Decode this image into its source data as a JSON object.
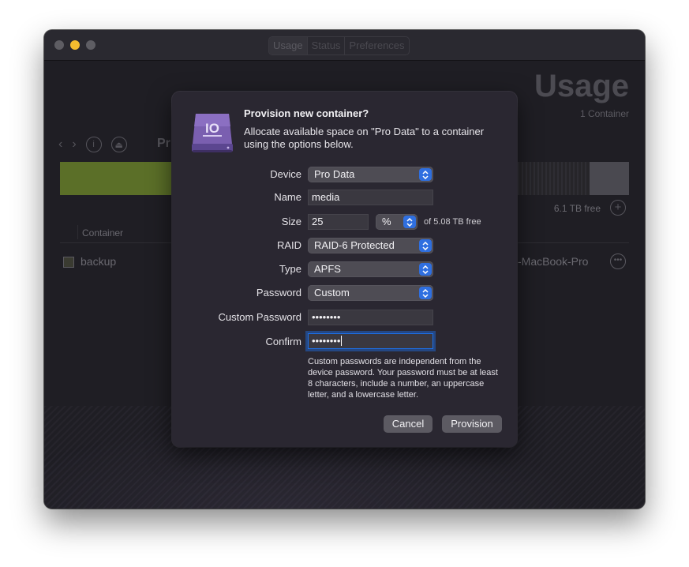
{
  "window": {
    "toolbar_tabs": [
      {
        "label": "Usage"
      },
      {
        "label": "Status"
      },
      {
        "label": "Preferences"
      }
    ]
  },
  "background": {
    "title": "Usage",
    "count": "1 Container",
    "crumb_partial": "Pr",
    "free": "6.1 TB free",
    "column_container": "Container",
    "row_name": "backup",
    "row_host": "-MacBook-Pro"
  },
  "sheet": {
    "icon_text": "IO",
    "title": "Provision new container?",
    "description": "Allocate available space on \"Pro Data\" to a container using the options below.",
    "device": {
      "label": "Device",
      "value": "Pro Data"
    },
    "name": {
      "label": "Name",
      "value": "media"
    },
    "size": {
      "label": "Size",
      "value": "25",
      "unit": "%",
      "free_text": "of 5.08 TB free"
    },
    "raid": {
      "label": "RAID",
      "value": "RAID-6 Protected"
    },
    "type": {
      "label": "Type",
      "value": "APFS"
    },
    "password": {
      "label": "Password",
      "value": "Custom"
    },
    "custom_password": {
      "label": "Custom Password",
      "value": "••••••••"
    },
    "confirm": {
      "label": "Confirm",
      "value": "••••••••"
    },
    "help_text": "Custom passwords are independent from the device password. Your password must be at least 8 characters, include a number, an uppercase letter, and a lowercase letter.",
    "cancel_label": "Cancel",
    "provision_label": "Provision"
  },
  "colors": {
    "accent": "#2f6fe0",
    "usage_bar": "#5b6f28",
    "minimize_light": "#f5bd2f"
  }
}
